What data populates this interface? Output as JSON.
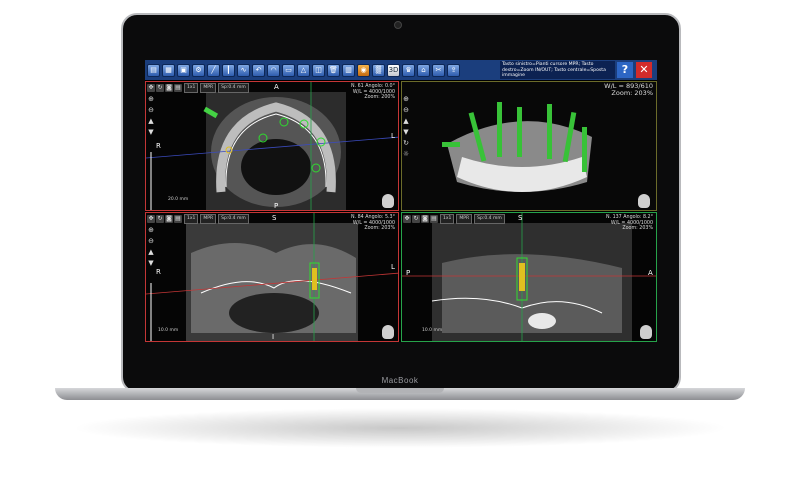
{
  "device": {
    "brand": "MacBook"
  },
  "app": {
    "status_text": "Tasto sinistro=Pianti cursore MPR; Tasto destro=Zoom IN/OUT; Tasto centrale=Sposta immagine",
    "help_label": "?",
    "close_label": "✕",
    "toolbar_icons": [
      "open-icon",
      "save-icon",
      "print-icon",
      "settings-icon",
      "ruler-icon",
      "implant-icon",
      "nerve-icon",
      "undo-icon",
      "panoramic-icon",
      "cut-icon",
      "measure-icon",
      "volume-icon",
      "delete-icon",
      "render-icon",
      "3d-icon",
      "mpr-icon",
      "tooth-icon",
      "crown-icon",
      "guide-icon",
      "scissors-icon",
      "export-icon"
    ]
  },
  "viewports": {
    "axial": {
      "chip_1x1": "1x1",
      "chip_mpr": "MPR",
      "chip_sp": "Sp:0.4 mm",
      "info": [
        "N. 61 Angolo: 0.0°",
        "W/L = 4000/1000",
        "Zoom: 200%"
      ],
      "orient_top": "A",
      "orient_left": "R",
      "orient_right": "L",
      "orient_bottom": "P",
      "scale": "20.0 mm"
    },
    "render3d": {
      "info": [
        "W/L = 893/610",
        "Zoom: 203%"
      ]
    },
    "coronal": {
      "chip_1x1": "1x1",
      "chip_mpr": "MPR",
      "chip_sp": "Sp:0.4 mm",
      "info": [
        "N. 84 Angolo: 5.3°",
        "W/L = 4000/1000",
        "Zoom: 203%"
      ],
      "orient_top": "S",
      "orient_left": "R",
      "orient_right": "L",
      "orient_bottom": "I",
      "scale": "10.0 mm"
    },
    "sagittal": {
      "chip_1x1": "1x1",
      "chip_mpr": "MPR",
      "chip_sp": "Sp:0.4 mm",
      "info": [
        "N. 137 Angolo: 8.2°",
        "W/L = 4000/1000",
        "Zoom: 203%"
      ],
      "orient_top": "S",
      "orient_left": "P",
      "orient_right": "A",
      "scale": "10.0 mm"
    }
  }
}
